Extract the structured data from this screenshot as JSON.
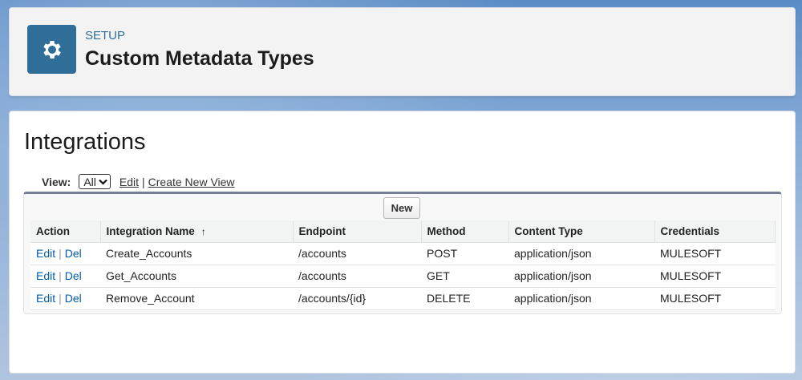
{
  "header": {
    "eyebrow": "SETUP",
    "title": "Custom Metadata Types",
    "icon": "gear-icon"
  },
  "page": {
    "title": "Integrations"
  },
  "view_bar": {
    "label": "View:",
    "selected": "All",
    "edit_link": "Edit",
    "separator": "|",
    "create_link": "Create New View"
  },
  "list": {
    "new_button": "New",
    "columns": [
      "Action",
      "Integration Name",
      "Endpoint",
      "Method",
      "Content Type",
      "Credentials"
    ],
    "sort_indicator": "↑",
    "action_edit": "Edit",
    "action_sep": "|",
    "action_del": "Del",
    "rows": [
      {
        "name": "Create_Accounts",
        "endpoint": "/accounts",
        "method": "POST",
        "content_type": "application/json",
        "credentials": "MULESOFT"
      },
      {
        "name": "Get_Accounts",
        "endpoint": "/accounts",
        "method": "GET",
        "content_type": "application/json",
        "credentials": "MULESOFT"
      },
      {
        "name": "Remove_Account",
        "endpoint": "/accounts/{id}",
        "method": "DELETE",
        "content_type": "application/json",
        "credentials": "MULESOFT"
      }
    ]
  },
  "colors": {
    "accent": "#2e6e99",
    "link": "#015ba7"
  }
}
